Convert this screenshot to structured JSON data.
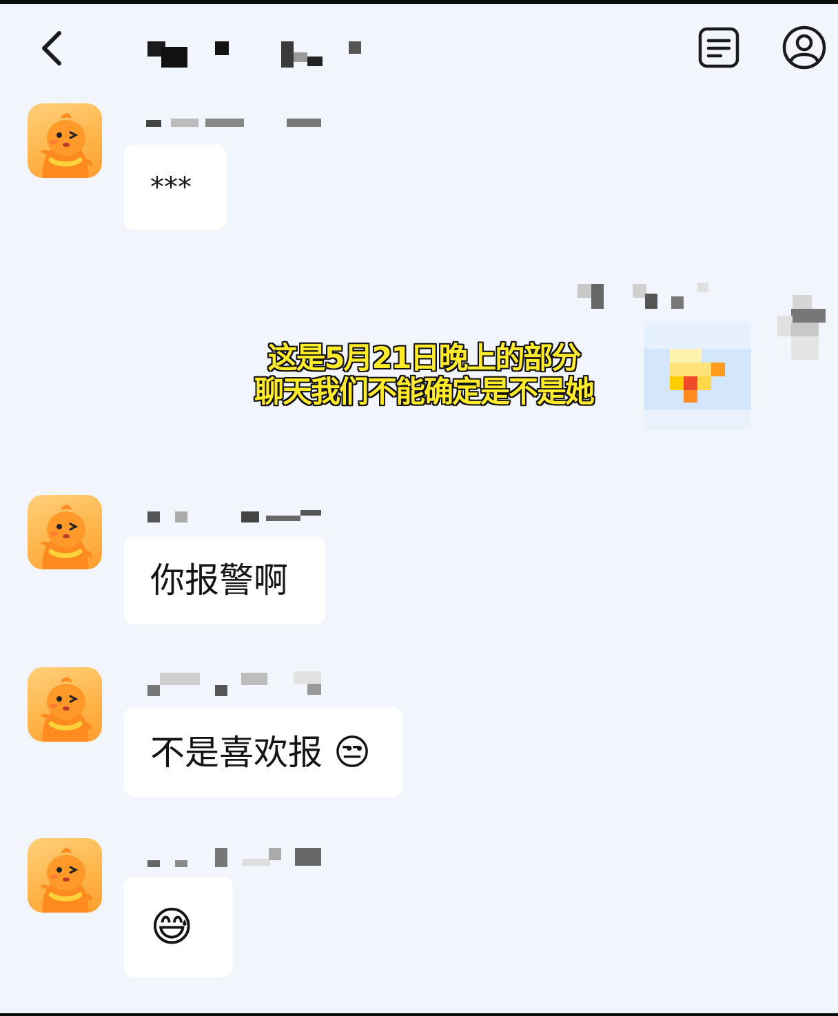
{
  "header": {
    "back_icon": "chevron-left-icon",
    "right_icons": [
      "list-document-icon",
      "profile-icon"
    ]
  },
  "messages": [
    {
      "side": "left",
      "text": "***"
    },
    {
      "side": "right",
      "image": "sticker"
    },
    {
      "side": "left",
      "text": "你报警啊"
    },
    {
      "side": "left",
      "text": "不是喜欢报",
      "emoji": "😒"
    },
    {
      "side": "left",
      "emoji": "😅"
    }
  ],
  "overlay": {
    "caption_line1": "这是5月21日晚上的部分",
    "caption_line2": "聊天我们不能确定是不是她"
  },
  "colors": {
    "background": "#f2f5fb",
    "bubble": "#ffffff",
    "caption": "#ffeb2a",
    "avatar": "#ffb347"
  }
}
